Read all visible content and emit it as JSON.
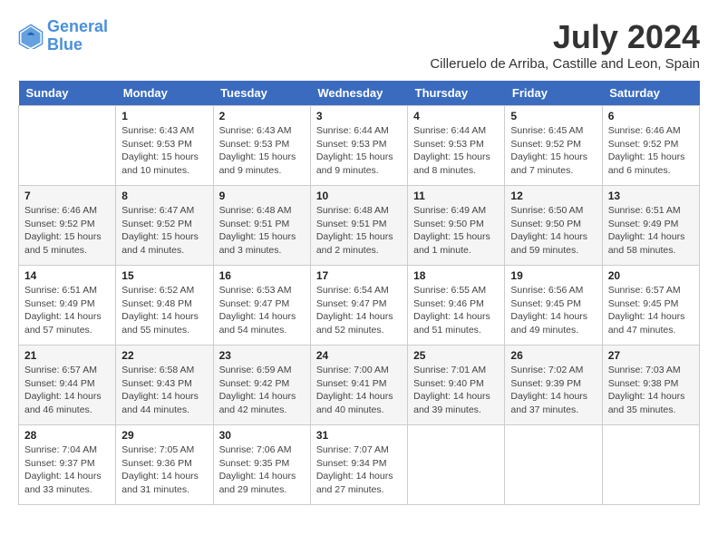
{
  "header": {
    "logo_line1": "General",
    "logo_line2": "Blue",
    "month_year": "July 2024",
    "location": "Cilleruelo de Arriba, Castille and Leon, Spain"
  },
  "weekdays": [
    "Sunday",
    "Monday",
    "Tuesday",
    "Wednesday",
    "Thursday",
    "Friday",
    "Saturday"
  ],
  "weeks": [
    [
      {
        "day": "",
        "info": ""
      },
      {
        "day": "1",
        "info": "Sunrise: 6:43 AM\nSunset: 9:53 PM\nDaylight: 15 hours\nand 10 minutes."
      },
      {
        "day": "2",
        "info": "Sunrise: 6:43 AM\nSunset: 9:53 PM\nDaylight: 15 hours\nand 9 minutes."
      },
      {
        "day": "3",
        "info": "Sunrise: 6:44 AM\nSunset: 9:53 PM\nDaylight: 15 hours\nand 9 minutes."
      },
      {
        "day": "4",
        "info": "Sunrise: 6:44 AM\nSunset: 9:53 PM\nDaylight: 15 hours\nand 8 minutes."
      },
      {
        "day": "5",
        "info": "Sunrise: 6:45 AM\nSunset: 9:52 PM\nDaylight: 15 hours\nand 7 minutes."
      },
      {
        "day": "6",
        "info": "Sunrise: 6:46 AM\nSunset: 9:52 PM\nDaylight: 15 hours\nand 6 minutes."
      }
    ],
    [
      {
        "day": "7",
        "info": "Sunrise: 6:46 AM\nSunset: 9:52 PM\nDaylight: 15 hours\nand 5 minutes."
      },
      {
        "day": "8",
        "info": "Sunrise: 6:47 AM\nSunset: 9:52 PM\nDaylight: 15 hours\nand 4 minutes."
      },
      {
        "day": "9",
        "info": "Sunrise: 6:48 AM\nSunset: 9:51 PM\nDaylight: 15 hours\nand 3 minutes."
      },
      {
        "day": "10",
        "info": "Sunrise: 6:48 AM\nSunset: 9:51 PM\nDaylight: 15 hours\nand 2 minutes."
      },
      {
        "day": "11",
        "info": "Sunrise: 6:49 AM\nSunset: 9:50 PM\nDaylight: 15 hours\nand 1 minute."
      },
      {
        "day": "12",
        "info": "Sunrise: 6:50 AM\nSunset: 9:50 PM\nDaylight: 14 hours\nand 59 minutes."
      },
      {
        "day": "13",
        "info": "Sunrise: 6:51 AM\nSunset: 9:49 PM\nDaylight: 14 hours\nand 58 minutes."
      }
    ],
    [
      {
        "day": "14",
        "info": "Sunrise: 6:51 AM\nSunset: 9:49 PM\nDaylight: 14 hours\nand 57 minutes."
      },
      {
        "day": "15",
        "info": "Sunrise: 6:52 AM\nSunset: 9:48 PM\nDaylight: 14 hours\nand 55 minutes."
      },
      {
        "day": "16",
        "info": "Sunrise: 6:53 AM\nSunset: 9:47 PM\nDaylight: 14 hours\nand 54 minutes."
      },
      {
        "day": "17",
        "info": "Sunrise: 6:54 AM\nSunset: 9:47 PM\nDaylight: 14 hours\nand 52 minutes."
      },
      {
        "day": "18",
        "info": "Sunrise: 6:55 AM\nSunset: 9:46 PM\nDaylight: 14 hours\nand 51 minutes."
      },
      {
        "day": "19",
        "info": "Sunrise: 6:56 AM\nSunset: 9:45 PM\nDaylight: 14 hours\nand 49 minutes."
      },
      {
        "day": "20",
        "info": "Sunrise: 6:57 AM\nSunset: 9:45 PM\nDaylight: 14 hours\nand 47 minutes."
      }
    ],
    [
      {
        "day": "21",
        "info": "Sunrise: 6:57 AM\nSunset: 9:44 PM\nDaylight: 14 hours\nand 46 minutes."
      },
      {
        "day": "22",
        "info": "Sunrise: 6:58 AM\nSunset: 9:43 PM\nDaylight: 14 hours\nand 44 minutes."
      },
      {
        "day": "23",
        "info": "Sunrise: 6:59 AM\nSunset: 9:42 PM\nDaylight: 14 hours\nand 42 minutes."
      },
      {
        "day": "24",
        "info": "Sunrise: 7:00 AM\nSunset: 9:41 PM\nDaylight: 14 hours\nand 40 minutes."
      },
      {
        "day": "25",
        "info": "Sunrise: 7:01 AM\nSunset: 9:40 PM\nDaylight: 14 hours\nand 39 minutes."
      },
      {
        "day": "26",
        "info": "Sunrise: 7:02 AM\nSunset: 9:39 PM\nDaylight: 14 hours\nand 37 minutes."
      },
      {
        "day": "27",
        "info": "Sunrise: 7:03 AM\nSunset: 9:38 PM\nDaylight: 14 hours\nand 35 minutes."
      }
    ],
    [
      {
        "day": "28",
        "info": "Sunrise: 7:04 AM\nSunset: 9:37 PM\nDaylight: 14 hours\nand 33 minutes."
      },
      {
        "day": "29",
        "info": "Sunrise: 7:05 AM\nSunset: 9:36 PM\nDaylight: 14 hours\nand 31 minutes."
      },
      {
        "day": "30",
        "info": "Sunrise: 7:06 AM\nSunset: 9:35 PM\nDaylight: 14 hours\nand 29 minutes."
      },
      {
        "day": "31",
        "info": "Sunrise: 7:07 AM\nSunset: 9:34 PM\nDaylight: 14 hours\nand 27 minutes."
      },
      {
        "day": "",
        "info": ""
      },
      {
        "day": "",
        "info": ""
      },
      {
        "day": "",
        "info": ""
      }
    ]
  ]
}
